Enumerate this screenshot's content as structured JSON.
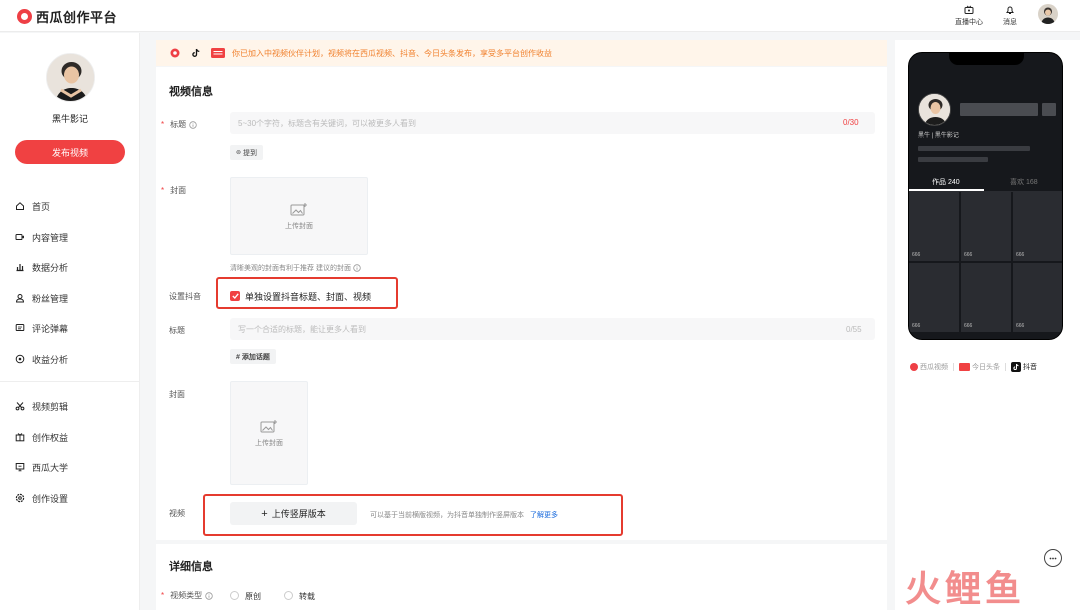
{
  "topbar": {
    "logo_text": "西瓜创作平台",
    "live_label": "直播中心",
    "message_label": "消息"
  },
  "sidebar": {
    "user_name": "黑牛影记",
    "publish_label": "发布视频",
    "items": [
      {
        "label": "首页",
        "icon": "home-icon"
      },
      {
        "label": "内容管理",
        "icon": "video-icon"
      },
      {
        "label": "数据分析",
        "icon": "chart-icon"
      },
      {
        "label": "粉丝管理",
        "icon": "user-icon"
      },
      {
        "label": "评论弹幕",
        "icon": "comment-icon"
      },
      {
        "label": "收益分析",
        "icon": "coin-icon"
      }
    ],
    "items2": [
      {
        "label": "视频剪辑",
        "icon": "scissors-icon"
      },
      {
        "label": "创作权益",
        "icon": "gift-icon"
      },
      {
        "label": "西瓜大学",
        "icon": "school-icon"
      },
      {
        "label": "创作设置",
        "icon": "gear-icon"
      }
    ]
  },
  "banner": {
    "text": "你已加入中视频伙伴计划，视频将在西瓜视频、抖音、今日头条发布，享受多平台创作收益"
  },
  "video_info": {
    "section_title": "视频信息",
    "title_label": "标题",
    "title_placeholder": "5~30个字符，标题含有关键词，可以被更多人看到",
    "title_counter": "0/30",
    "mention_label": "提到",
    "cover_label": "封面",
    "upload_cover_label": "上传封面",
    "cover_hint": "清晰美观的封面有利于推荐  建议的封面",
    "douyin_label": "设置抖音",
    "douyin_check_label": "单独设置抖音标题、封面、视频",
    "dy_title_label": "标题",
    "dy_title_placeholder": "写一个合适的标题，能让更多人看到",
    "dy_title_counter": "0/55",
    "add_topic_label": "# 添加话题",
    "dy_cover_label": "封面",
    "dy_upload_cover_label": "上传封面",
    "video_label": "视频",
    "upload_vertical_label": "上传竖屏版本",
    "video_hint": "可以基于当前横版视频，为抖音单独制作竖屏版本",
    "learn_more": "了解更多"
  },
  "detail": {
    "section_title": "详细信息",
    "type_label": "视频类型",
    "option_original": "原创",
    "option_repost": "转载"
  },
  "preview": {
    "name_line": "黑牛 | 黑牛影记",
    "tab_works": "作品 240",
    "tab_likes": "喜欢 168",
    "cell_counts": [
      "666",
      "666",
      "666",
      "666",
      "666",
      "666"
    ],
    "platforms": [
      "西瓜视频",
      "今日头条",
      "抖音"
    ]
  },
  "colors": {
    "accent": "#f04142",
    "banner_text": "#f0812e",
    "link": "#1668dc",
    "highlight_box": "#e53b2f"
  },
  "watermark": "火鲤鱼"
}
